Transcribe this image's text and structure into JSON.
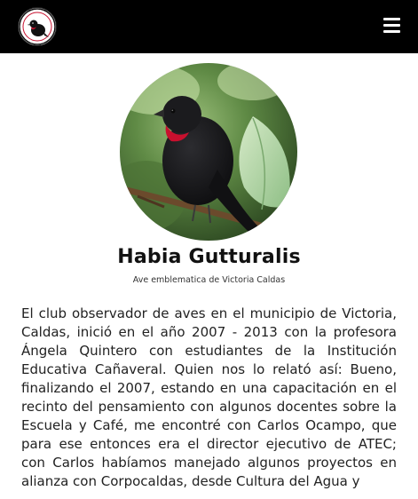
{
  "header": {
    "logo_icon": "club-logo-bird-icon",
    "menu_icon": "hamburger-menu-icon"
  },
  "profile": {
    "image_icon": "bird-photo",
    "name": "Habia Gutturalis",
    "subtitle": "Ave emblematica de Victoria Caldas"
  },
  "content": {
    "paragraph": "El club observador de aves en el municipio de Victoria, Caldas, inició en el año 2007 - 2013 con la profesora Ángela Quintero con estudiantes de la Institución Educativa Cañaveral. Quien nos lo relató así: Bueno, finalizando el 2007, estando en una capacitación en el recinto del pensamiento con algunos docentes sobre la Escuela y Café, me encontré con Carlos Ocampo, que para ese entonces era el director ejecutivo de ATEC; con Carlos habíamos manejado algunos proyectos en alianza con Corpocaldas, desde Cultura del Agua y"
  },
  "colors": {
    "header_bg": "#000000",
    "bird_throat": "#c8102e"
  }
}
